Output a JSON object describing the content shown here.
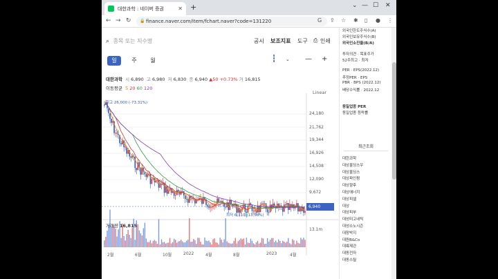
{
  "browser": {
    "tab_title": "대한과학 : 네이버 증권",
    "new_tab": "+",
    "url": "finance.naver.com/item/fchart.naver?code=131220"
  },
  "toolbar": {
    "search_placeholder": "종목 또는 지수명",
    "menu": [
      "공시",
      "보조지표",
      "도구",
      "인쇄"
    ]
  },
  "periods": [
    {
      "label": "일",
      "selected": true
    },
    {
      "label": "주",
      "selected": false
    },
    {
      "label": "월",
      "selected": false
    }
  ],
  "stock": {
    "name": "대한과학",
    "open_label": "시",
    "open": "6,890",
    "high_label": "고",
    "high": "6,980",
    "low_label": "저",
    "low": "6,830",
    "close_label": "종",
    "close": "6,940",
    "change": "▲50",
    "change_pct": "+0.73%",
    "vol_label": "거",
    "volume": "16,815"
  },
  "ma": {
    "label": "이동평균",
    "values": [
      "5",
      "20",
      "60",
      "120"
    ]
  },
  "scale_mode": "Linear",
  "y_ticks": [
    "24,180",
    "21,762",
    "19,344",
    "16,926",
    "14,508",
    "12,090",
    "9,672"
  ],
  "current_price_tag": "6,940",
  "high_annotation": "최고 26,000 (-73.31%)",
  "low_annotation": "최저 6,110 (13.58%)",
  "volume": {
    "label": "거래량",
    "value": "16,815",
    "max_tick": "13.1m"
  },
  "x_ticks": [
    "2월",
    "6월",
    "10월",
    "2022",
    "4월",
    "8월",
    "2023",
    "4월"
  ],
  "side": {
    "top_lines": [
      "외국인한도주식수(A)",
      "외국인보유주식수(B)",
      "외국인소진율(B/A)"
    ],
    "invest": [
      "투자의견 · 목표주가",
      "52주최고 · 최저"
    ],
    "ratios": [
      "PER · EPS(2022.12)",
      "추정PER · EPS",
      "PBR · BPS (2022.12)",
      "배당수익률 · 2022.12"
    ],
    "sector": [
      "동일업종 PER",
      "동일업종 등락률"
    ],
    "recent_header": "최근조회",
    "recent": [
      "대한과학",
      "대상홀딩스우",
      "대상홀딩스",
      "대상파인팜",
      "대상향후",
      "대상에너지",
      "대상피셀",
      "대상",
      "대상피부",
      "대성미고네틱",
      "대성소노시즌",
      "대창박지",
      "대원B&Co",
      "대륙제관",
      "대동전자",
      "대동스틸"
    ]
  },
  "colors": {
    "accent": "#3b63c4",
    "up": "#d32f2f",
    "down": "#2b5cb8"
  }
}
